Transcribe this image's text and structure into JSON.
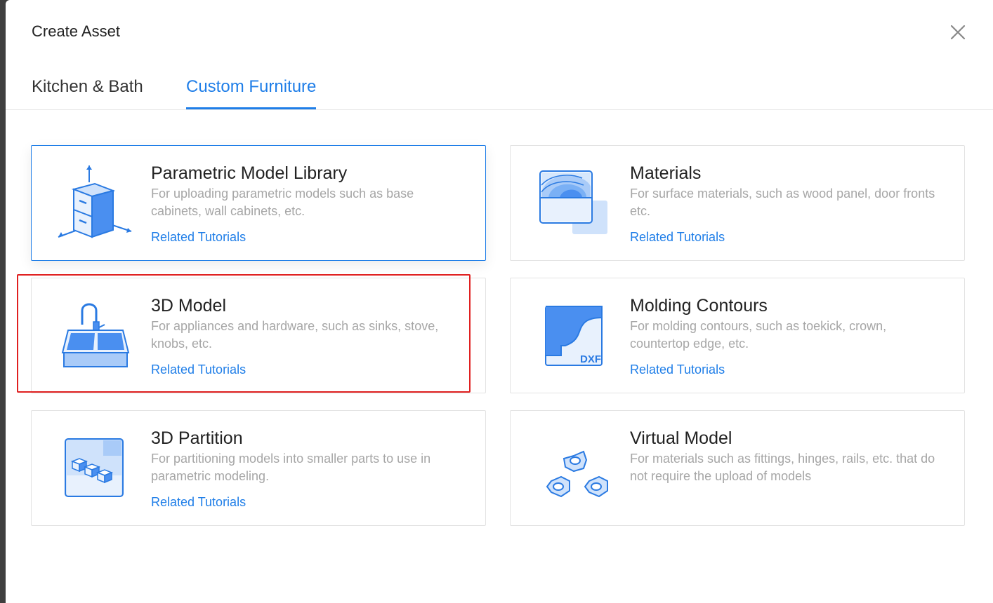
{
  "modal": {
    "title": "Create Asset"
  },
  "tabs": [
    {
      "label": "Kitchen & Bath",
      "active": false
    },
    {
      "label": "Custom Furniture",
      "active": true
    }
  ],
  "cards": [
    {
      "title": "Parametric Model Library",
      "description": "For uploading parametric models such as base cabinets, wall cabinets, etc.",
      "link": "Related Tutorials",
      "icon": "cabinet-axes-icon"
    },
    {
      "title": "Materials",
      "description": "For surface materials, such as wood panel, door fronts etc.",
      "link": "Related Tutorials",
      "icon": "wood-grain-material-icon"
    },
    {
      "title": "3D Model",
      "description": "For appliances and hardware, such as sinks, stove, knobs, etc.",
      "link": "Related Tutorials",
      "icon": "sink-icon"
    },
    {
      "title": "Molding Contours",
      "description": "For molding contours, such as toekick, crown, countertop edge, etc.",
      "link": "Related Tutorials",
      "icon": "dxf-molding-icon",
      "icon_text": "DXF"
    },
    {
      "title": "3D Partition",
      "description": "For partitioning models into smaller parts to use in parametric modeling.",
      "link": "Related Tutorials",
      "icon": "partition-cubes-icon"
    },
    {
      "title": "Virtual Model",
      "description": "For materials such as fittings, hinges, rails, etc. that do not require the upload of models",
      "icon": "hex-nuts-icon"
    }
  ],
  "colors": {
    "accent": "#1f7ee8",
    "highlight": "#e02020"
  }
}
